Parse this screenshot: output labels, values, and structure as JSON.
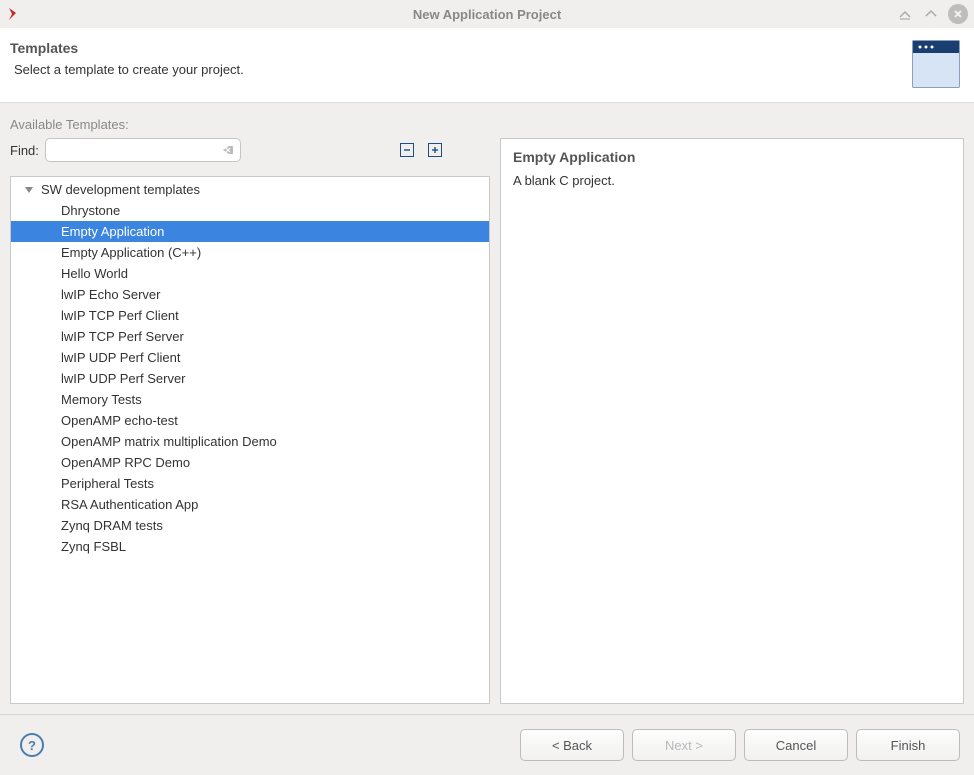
{
  "window": {
    "title": "New Application Project"
  },
  "banner": {
    "heading": "Templates",
    "subheading": "Select a template to create your project."
  },
  "content": {
    "available_label": "Available Templates:",
    "find_label": "Find:",
    "find_value": "",
    "tree_group": "SW development templates",
    "templates": [
      "Dhrystone",
      "Empty Application",
      "Empty Application (C++)",
      "Hello World",
      "lwIP Echo Server",
      "lwIP TCP Perf Client",
      "lwIP TCP Perf Server",
      "lwIP UDP Perf Client",
      "lwIP UDP Perf Server",
      "Memory Tests",
      "OpenAMP echo-test",
      "OpenAMP matrix multiplication Demo",
      "OpenAMP RPC Demo",
      "Peripheral Tests",
      "RSA Authentication App",
      "Zynq DRAM tests",
      "Zynq FSBL"
    ],
    "selected_index": 1
  },
  "description": {
    "title": "Empty Application",
    "body": "A blank C project."
  },
  "footer": {
    "help_symbol": "?",
    "back": "< Back",
    "next": "Next >",
    "cancel": "Cancel",
    "finish": "Finish"
  }
}
